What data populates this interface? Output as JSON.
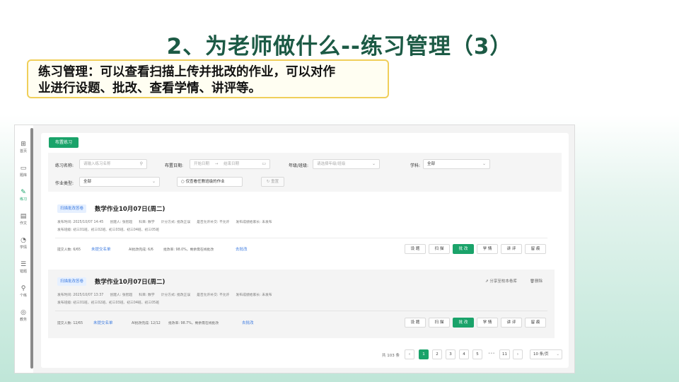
{
  "slide": {
    "title": "2、为老师做什么--练习管理（3）",
    "callout_line1": "练习管理：可以查看扫描上传并批改的作业，可以对作",
    "callout_line2": "业进行设题、批改、查看学情、讲评等。"
  },
  "sidebar": {
    "items": [
      {
        "label": "首页",
        "icon": "grid-icon",
        "glyph": "⊞"
      },
      {
        "label": "题库",
        "icon": "folder-icon",
        "glyph": "▭"
      },
      {
        "label": "练习",
        "icon": "pencil-icon",
        "glyph": "✎"
      },
      {
        "label": "作文",
        "icon": "document-icon",
        "glyph": "▤"
      },
      {
        "label": "学情",
        "icon": "pie-chart-icon",
        "glyph": "◔"
      },
      {
        "label": "错题",
        "icon": "list-icon",
        "glyph": "☰"
      },
      {
        "label": "个练",
        "icon": "magnifier-icon",
        "glyph": "⚲"
      },
      {
        "label": "教务",
        "icon": "target-icon",
        "glyph": "◎"
      }
    ]
  },
  "toolbar": {
    "assign_label": "布置练习"
  },
  "filters": {
    "name_label": "练习名称:",
    "name_placeholder": "请输入练习名称",
    "date_label": "布置日期:",
    "date_start": "开始日期",
    "date_sep": "→",
    "date_end": "结束日期",
    "grade_label": "年级/班级:",
    "grade_placeholder": "请选择年级/班级",
    "subject_label": "学科:",
    "subject_value": "全部",
    "type_label": "作业类型:",
    "type_value": "全部",
    "own_only": "仅查看任教班级的作业",
    "reset": "重置"
  },
  "cards": [
    {
      "tag": "扫描批改答卷",
      "title": "数学作业10月07日(周二)",
      "meta": [
        "发布时间: 2025/10/07 14:45",
        "创建人: 张智超",
        "科目: 数学",
        "计分方式: 批改正误",
        "是否允许补交: 不允许",
        "发布成绩给家长: 未发布"
      ],
      "classes": "发布班级: 初三01班、初三02班、初三03班、初三04班、初三05班",
      "submitted": "提交人数: 6/65",
      "unsubmitted_link": "未提交名单",
      "ai_done": "AI批改完成: 6/6",
      "rate": "批改率: 98.0%，剩余需在线批改",
      "go_link": "去批改",
      "actions": [
        "设 题",
        "扫 描",
        "批 改",
        "学 情",
        "讲 评",
        "留 痕"
      ]
    },
    {
      "tag": "扫描批改答卷",
      "title": "数学作业10月07日(周二)",
      "meta": [
        "发布时间: 2025/10/07 13:37",
        "创建人: 张智超",
        "科目: 数学",
        "计分方式: 批改正误",
        "是否允许补交: 不允许",
        "发布成绩给家长: 未发布"
      ],
      "classes": "发布班级: 初三01班、初三02班、初三03班、初三04班、初三05班",
      "submitted": "提交人数: 12/65",
      "unsubmitted_link": "未提交名单",
      "ai_done": "AI批改完成: 12/12",
      "rate": "批改率: 98.7%，剩余需在线批改",
      "go_link": "去批改",
      "share": "分享至校本卷库",
      "delete": "删除",
      "actions": [
        "设 题",
        "扫 描",
        "批 改",
        "学 情",
        "讲 评",
        "留 痕"
      ]
    }
  ],
  "pagination": {
    "total": "共 103 条",
    "prev": "‹",
    "pages": [
      "1",
      "2",
      "3",
      "4",
      "5"
    ],
    "ellipsis": "•••",
    "last": "11",
    "next": "›",
    "page_size": "10 条/页"
  },
  "colors": {
    "accent": "#1aa36a",
    "title": "#1c5a45",
    "link": "#3d7be0",
    "callout_border": "#f0cf5a"
  }
}
